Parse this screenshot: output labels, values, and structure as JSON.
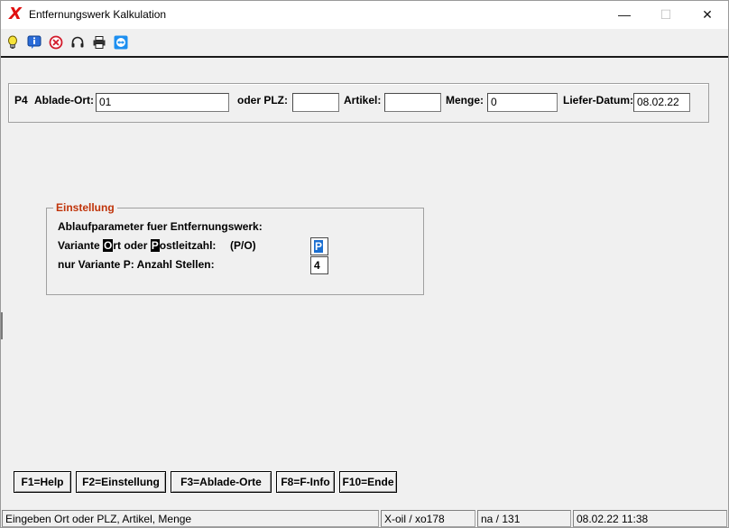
{
  "window": {
    "title": "Entfernungswerk Kalkulation",
    "app_icon": "X",
    "minimize_glyph": "—",
    "maximize_glyph": "☐",
    "close_glyph": "✕"
  },
  "toolbar": {
    "icons": [
      "lightbulb-icon",
      "info-icon",
      "cancel-icon",
      "headset-icon",
      "printer-icon",
      "teamviewer-icon"
    ]
  },
  "header": {
    "prefix": "P4",
    "ablade_ort_label": "Ablade-Ort:",
    "ablade_ort_value": "01",
    "plz_label": "oder PLZ:",
    "plz_value": "",
    "artikel_label": "Artikel:",
    "artikel_value": "",
    "menge_label": "Menge:",
    "menge_value": "0",
    "liefer_datum_label": "Liefer-Datum:",
    "liefer_datum_value": "08.02.22"
  },
  "einstellung": {
    "legend": "Einstellung",
    "line1": "Ablaufparameter fuer Entfernungswerk:",
    "line2_part1": "Variante ",
    "line2_hl1": "O",
    "line2_part2": "rt oder ",
    "line2_hl2": "P",
    "line2_part3": "ostleitzahl:",
    "line2_hint": "(P/O)",
    "variante_value": "P",
    "line3": "nur Variante P: Anzahl Stellen:",
    "stellen_value": "4"
  },
  "fkeys": {
    "f1": "F1=Help",
    "f2": "F2=Einstellung",
    "f3": "F3=Ablade-Orte",
    "f8": "F8=F-Info",
    "f10": "F10=Ende"
  },
  "status": {
    "message": "Eingeben Ort oder PLZ, Artikel, Menge",
    "user": "X-oil / xo178",
    "info": "na / 131",
    "datetime": "08.02.22 11:38"
  }
}
